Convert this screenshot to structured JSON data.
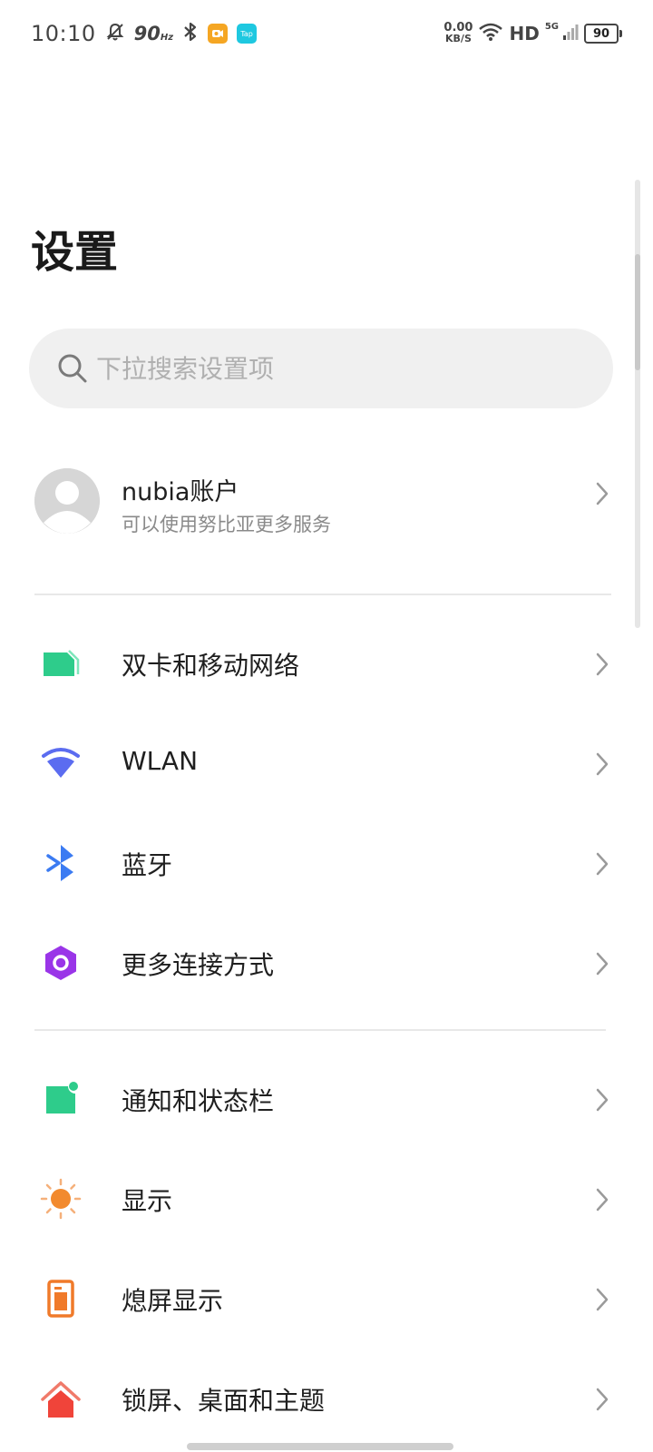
{
  "status_bar": {
    "time": "10:10",
    "refresh_rate": "90",
    "refresh_unit": "Hz",
    "app_badge_1": "",
    "app_badge_2": "Tap",
    "net_speed": "0.00",
    "net_unit": "KB/S",
    "hd": "HD",
    "network": "5G",
    "battery": "90"
  },
  "page": {
    "title": "设置"
  },
  "search": {
    "placeholder": "下拉搜索设置项"
  },
  "account": {
    "name": "nubia账户",
    "subtitle": "可以使用努比亚更多服务"
  },
  "groups": [
    {
      "items": [
        {
          "label": "双卡和移动网络",
          "icon": "sim-card-icon",
          "color": "#2ecc8b"
        },
        {
          "label": "WLAN",
          "icon": "wifi-icon",
          "color": "#5b6cf0"
        },
        {
          "label": "蓝牙",
          "icon": "bluetooth-icon",
          "color": "#3b7bf2"
        },
        {
          "label": "更多连接方式",
          "icon": "more-connections-icon",
          "color": "#9a35e8"
        }
      ]
    },
    {
      "items": [
        {
          "label": "通知和状态栏",
          "icon": "notification-icon",
          "color": "#2ecc8b"
        },
        {
          "label": "显示",
          "icon": "display-brightness-icon",
          "color": "#f28a2e"
        },
        {
          "label": "熄屏显示",
          "icon": "aod-icon",
          "color": "#f07a2a"
        },
        {
          "label": "锁屏、桌面和主题",
          "icon": "home-theme-icon",
          "color": "#f0443a"
        }
      ]
    }
  ],
  "colors": {
    "badge_orange": "#f5a623",
    "badge_teal": "#1ec8e0",
    "text_primary": "#1f1f1f",
    "text_secondary": "#8a8a8a",
    "search_bg": "#f0f0f0"
  }
}
